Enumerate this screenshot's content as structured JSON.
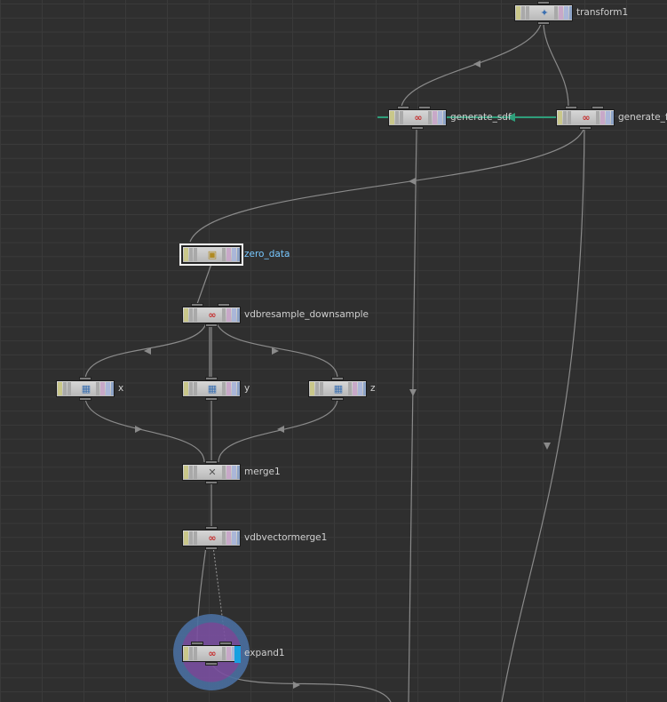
{
  "colors": {
    "background": "#2f2f2f",
    "wire": "#8a8a8a",
    "highlight_wire": "#2e9e7a",
    "selected_label": "#78c8ff",
    "display_flag": "#18a0e0"
  },
  "nodes": {
    "transform1": {
      "label": "transform1",
      "icon": "transform-icon"
    },
    "generate_sdf": {
      "label": "generate_sdf",
      "icon": "vdb-icon"
    },
    "generate_fog": {
      "label": "generate_fo",
      "icon": "vdb-icon"
    },
    "zero_data": {
      "label": "zero_data",
      "icon": "volume-wrangle-icon"
    },
    "vdbresample_downsample": {
      "label": "vdbresample_downsample",
      "icon": "vdb-icon"
    },
    "x": {
      "label": "x",
      "icon": "volume-icon"
    },
    "y": {
      "label": "y",
      "icon": "volume-icon"
    },
    "z": {
      "label": "z",
      "icon": "volume-icon"
    },
    "merge1": {
      "label": "merge1",
      "icon": "merge-icon"
    },
    "vdbvectormerge1": {
      "label": "vdbvectormerge1",
      "icon": "vdb-icon"
    },
    "expand1": {
      "label": "expand1",
      "icon": "vdb-icon"
    }
  }
}
